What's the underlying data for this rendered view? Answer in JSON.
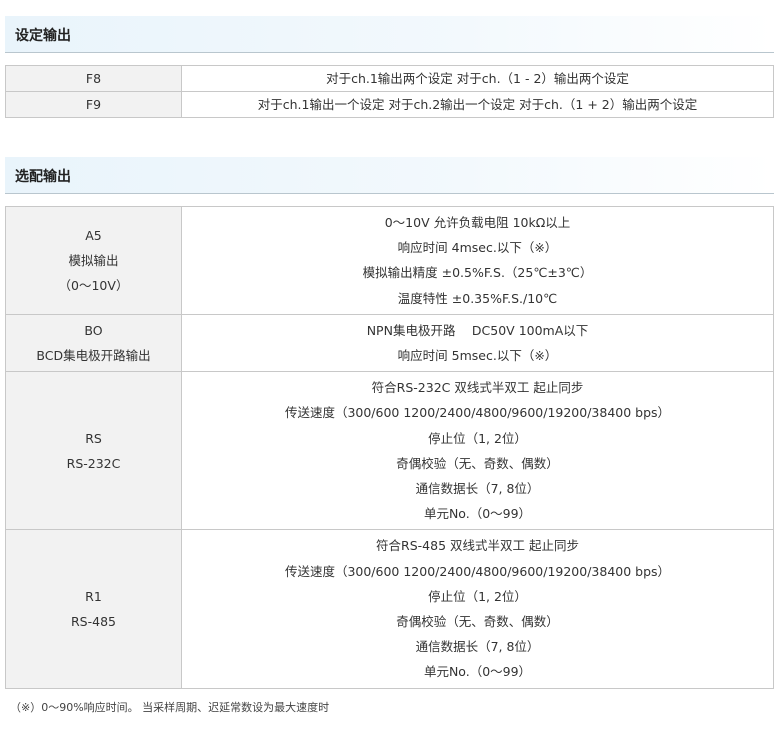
{
  "sections": {
    "settings": {
      "title": "设定输出",
      "rows": [
        {
          "key": [
            "F8"
          ],
          "value": [
            "对于ch.1输出两个设定 对于ch.（1 - 2）输出两个设定"
          ]
        },
        {
          "key": [
            "F9"
          ],
          "value": [
            "对于ch.1输出一个设定 对于ch.2输出一个设定 对于ch.（1 + 2）输出两个设定"
          ]
        }
      ]
    },
    "options": {
      "title": "选配输出",
      "rows": [
        {
          "key": [
            "A5",
            "模拟输出",
            "（0～10V）"
          ],
          "value": [
            "0～10V 允许负载电阻 10kΩ以上",
            "响应时间 4msec.以下（※）",
            "模拟输出精度 ±0.5%F.S.（25℃±3℃）",
            "温度特性 ±0.35%F.S./10℃"
          ]
        },
        {
          "key": [
            "BO",
            "BCD集电极开路输出"
          ],
          "value": [
            "NPN集电极开路　 DC50V 100mA以下",
            "响应时间 5msec.以下（※）"
          ]
        },
        {
          "key": [
            "RS",
            "RS-232C"
          ],
          "value": [
            "符合RS-232C 双线式半双工 起止同步",
            "传送速度（300/600 1200/2400/4800/9600/19200/38400 bps）",
            "停止位（1, 2位）",
            "奇偶校验（无、奇数、偶数）",
            "通信数据长（7, 8位）",
            "单元No.（0～99）"
          ]
        },
        {
          "key": [
            "R1",
            "RS-485"
          ],
          "value": [
            "符合RS-485 双线式半双工 起止同步",
            "传送速度（300/600 1200/2400/4800/9600/19200/38400 bps）",
            "停止位（1, 2位）",
            "奇偶校验（无、奇数、偶数）",
            "通信数据长（7, 8位）",
            "单元No.（0～99）"
          ]
        }
      ]
    }
  },
  "footnote": "（※）0～90%响应时间。 当采样周期、迟延常数设为最大速度时"
}
